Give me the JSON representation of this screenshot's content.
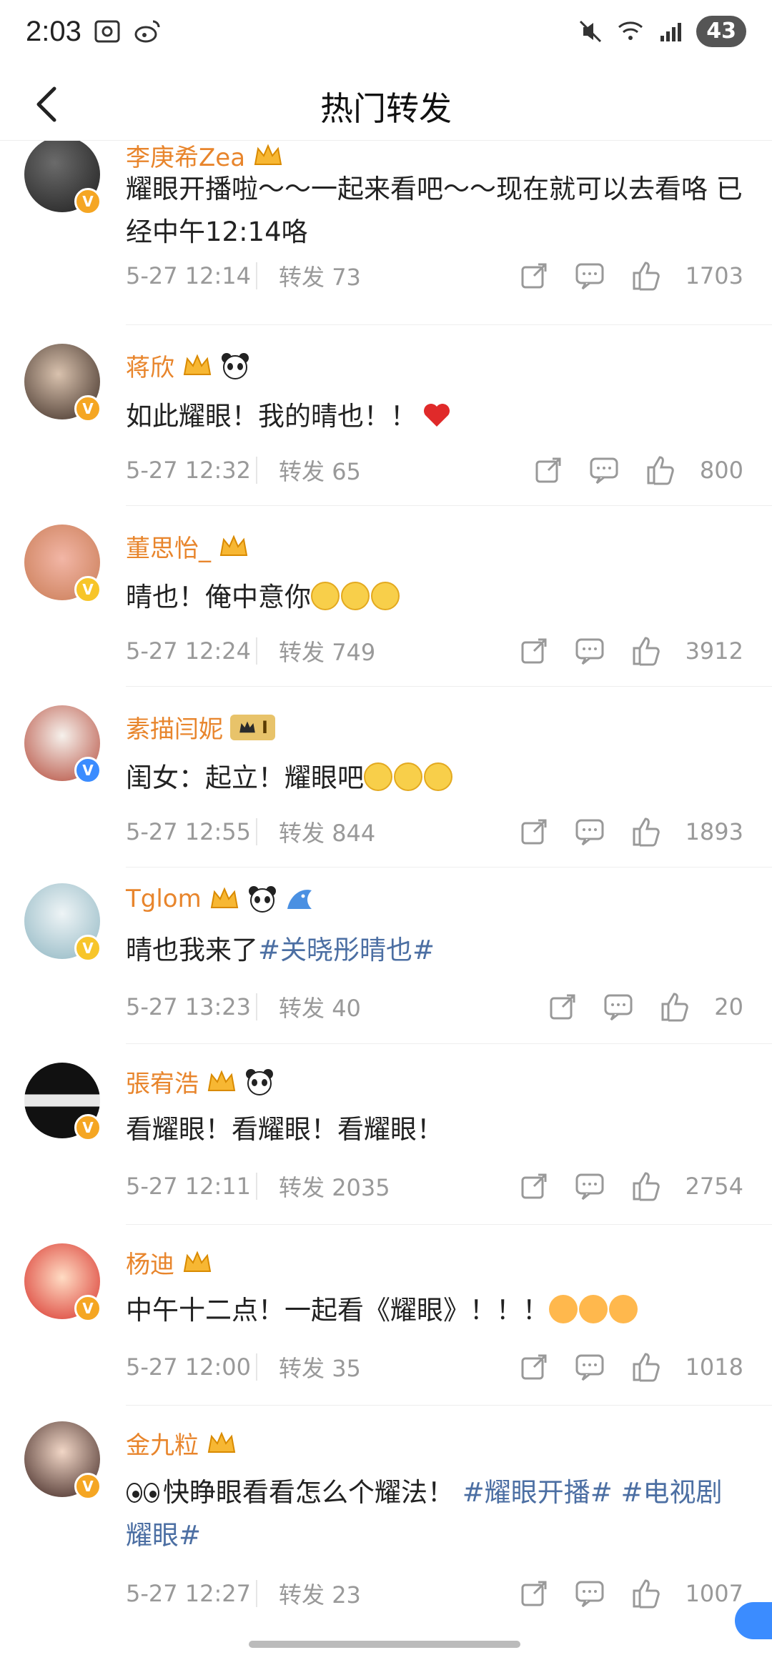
{
  "status_bar": {
    "time": "2:03",
    "battery": "43"
  },
  "nav": {
    "title": "热门转发"
  },
  "repost_label": "转发",
  "items": [
    {
      "name": "李庚希Zea",
      "content_parts": [
        "耀眼开播啦～～一起来看吧～～现在就可以去看咯 已经中午12:14咯"
      ],
      "date": "5-27 12:14",
      "reposts": "73",
      "likes": "1703"
    },
    {
      "name": "蒋欣",
      "content_parts": [
        "如此耀眼！我的晴也！！"
      ],
      "date": "5-27 12:32",
      "reposts": "65",
      "likes": "800"
    },
    {
      "name": "董思怡_",
      "content_parts": [
        "晴也！俺中意你"
      ],
      "date": "5-27 12:24",
      "reposts": "749",
      "likes": "3912"
    },
    {
      "name": "素描闫妮",
      "level": "I",
      "content_parts": [
        "闺女：起立！耀眼吧"
      ],
      "date": "5-27 12:55",
      "reposts": "844",
      "likes": "1893"
    },
    {
      "name": "Tglom",
      "content_parts": [
        "晴也我来了",
        "#关晓彤晴也#"
      ],
      "date": "5-27 13:23",
      "reposts": "40",
      "likes": "20"
    },
    {
      "name": "張宥浩",
      "content_parts": [
        "看耀眼！看耀眼！看耀眼！"
      ],
      "date": "5-27 12:11",
      "reposts": "2035",
      "likes": "2754"
    },
    {
      "name": "杨迪",
      "content_parts": [
        "中午十二点！一起看《耀眼》！！！"
      ],
      "date": "5-27 12:00",
      "reposts": "35",
      "likes": "1018"
    },
    {
      "name": "金九粒",
      "content_parts": [
        "快睁眼看看怎么个耀法！",
        "#耀眼开播#",
        "#电视剧耀眼#"
      ],
      "date": "5-27 12:27",
      "reposts": "23",
      "likes": "1007"
    }
  ]
}
